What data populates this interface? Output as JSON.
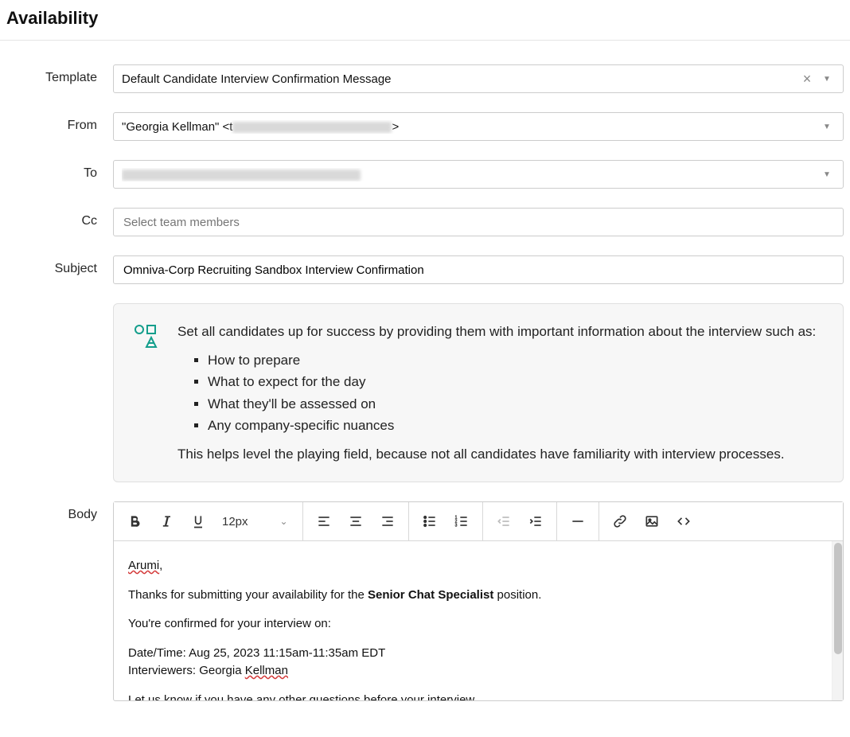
{
  "page": {
    "title": "Availability"
  },
  "labels": {
    "template": "Template",
    "from": "From",
    "to": "To",
    "cc": "Cc",
    "subject": "Subject",
    "body": "Body"
  },
  "template": {
    "selected": "Default Candidate Interview Confirmation Message"
  },
  "from": {
    "prefix": "\"Georgia Kellman\" <t",
    "suffix": ">"
  },
  "cc": {
    "placeholder": "Select team members"
  },
  "subject": {
    "value": "Omniva-Corp Recruiting Sandbox Interview Confirmation"
  },
  "info": {
    "intro": "Set all candidates up for success by providing them with important information about the interview such as:",
    "bullets": [
      "How to prepare",
      "What to expect for the day",
      "What they'll be assessed on",
      "Any company-specific nuances"
    ],
    "outro": "This helps level the playing field, because not all candidates have familiarity with interview processes."
  },
  "toolbar": {
    "font_size": "12px"
  },
  "body": {
    "greeting_name": "Arumi",
    "greeting_comma": ",",
    "thanks_pre": "Thanks for submitting your availability for the ",
    "position": "Senior Chat Specialist",
    "thanks_post": " position.",
    "confirm_line": "You're confirmed for your interview on:",
    "datetime_line": "Date/Time: Aug 25, 2023 11:15am-11:35am EDT",
    "interviewers_pre": "Interviewers: Georgia ",
    "interviewers_last": "Kellman",
    "footer_line": "Let us know if you have any other questions before your interview."
  }
}
